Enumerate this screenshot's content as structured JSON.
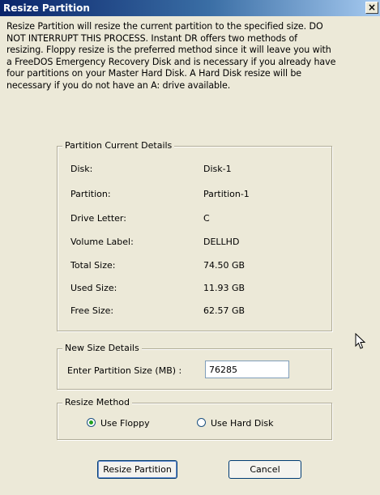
{
  "window": {
    "title": "Resize Partition",
    "close_label": "×"
  },
  "description_lines": [
    "Resize Partition will resize the current partition to the specified size.  DO",
    "NOT INTERRUPT THIS PROCESS. Instant DR offers two methods of",
    "resizing.  Floppy resize is the preferred method since it will leave you with",
    "a FreeDOS Emergency Recovery Disk and is necessary if you already have",
    "four partitions on your Master Hard Disk.  A Hard Disk resize will be",
    "necessary if you do not have an A: drive available."
  ],
  "partition_details": {
    "legend": "Partition Current Details",
    "rows": [
      {
        "label": "Disk:",
        "value": "Disk-1"
      },
      {
        "label": "Partition:",
        "value": "Partition-1"
      },
      {
        "label": "Drive Letter:",
        "value": "C"
      },
      {
        "label": "Volume Label:",
        "value": "DELLHD"
      },
      {
        "label": "Total Size:",
        "value": "74.50 GB"
      },
      {
        "label": "Used Size:",
        "value": "11.93 GB"
      },
      {
        "label": "Free Size:",
        "value": "62.57 GB"
      }
    ]
  },
  "new_size": {
    "legend": "New Size Details",
    "label": "Enter Partition Size (MB) :",
    "value": "76285"
  },
  "resize_method": {
    "legend": "Resize Method",
    "options": [
      {
        "label": "Use Floppy",
        "selected": true
      },
      {
        "label": "Use Hard Disk",
        "selected": false
      }
    ]
  },
  "buttons": {
    "resize": "Resize Partition",
    "cancel": "Cancel"
  }
}
